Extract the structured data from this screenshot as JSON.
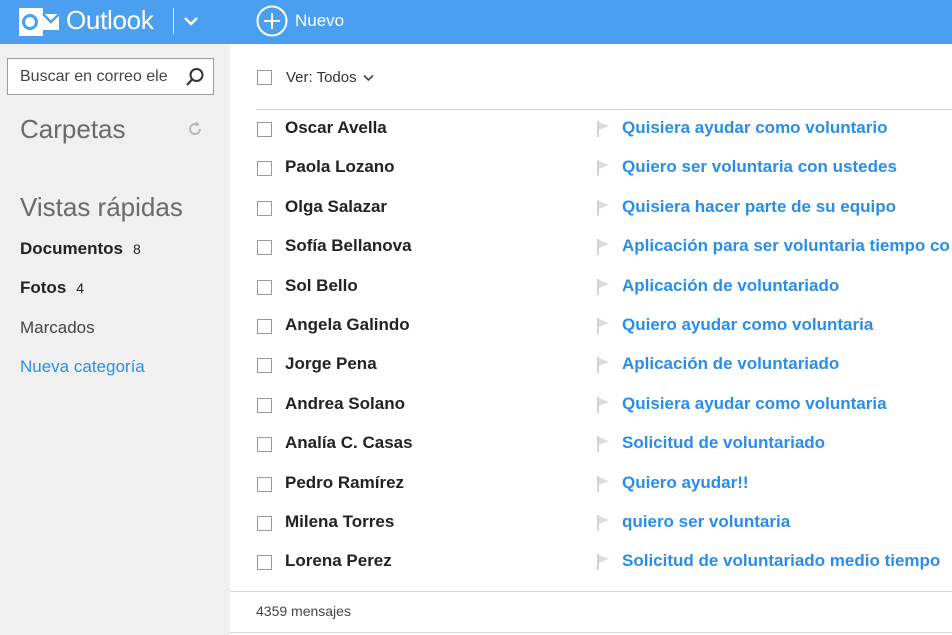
{
  "header": {
    "brand": "Outlook",
    "new_label": "Nuevo"
  },
  "sidebar": {
    "search_placeholder": "Buscar en correo ele",
    "folders_title": "Carpetas",
    "quick_views_title": "Vistas rápidas",
    "quick_views": [
      {
        "label": "Documentos",
        "count": "8"
      },
      {
        "label": "Fotos",
        "count": "4"
      },
      {
        "label": "Marcados"
      }
    ],
    "new_category": "Nueva categoría"
  },
  "toolbar": {
    "filter_label": "Ver: Todos"
  },
  "messages": [
    {
      "sender": "Oscar Avella",
      "subject": "Quisiera ayudar como voluntario"
    },
    {
      "sender": "Paola Lozano",
      "subject": "Quiero ser voluntaria con ustedes"
    },
    {
      "sender": "Olga Salazar",
      "subject": "Quisiera hacer parte de su equipo"
    },
    {
      "sender": "Sofía Bellanova",
      "subject": "Aplicación para ser voluntaria tiempo co"
    },
    {
      "sender": "Sol Bello",
      "subject": "Aplicación de voluntariado"
    },
    {
      "sender": "Angela Galindo",
      "subject": "Quiero ayudar como voluntaria"
    },
    {
      "sender": "Jorge Pena",
      "subject": "Aplicación de voluntariado"
    },
    {
      "sender": "Andrea Solano",
      "subject": "Quisiera ayudar como voluntaria"
    },
    {
      "sender": "Analía C. Casas",
      "subject": "Solicitud de voluntariado"
    },
    {
      "sender": "Pedro Ramírez",
      "subject": "Quiero ayudar!!"
    },
    {
      "sender": "Milena Torres",
      "subject": "quiero ser voluntaria"
    },
    {
      "sender": "Lorena Perez",
      "subject": "Solicitud de voluntariado medio tiempo"
    }
  ],
  "footer": {
    "message_count": "4359 mensajes"
  },
  "colors": {
    "accent": "#4a9ff0",
    "link": "#2a8ee8",
    "sidebar_bg": "#f0f0f0"
  }
}
